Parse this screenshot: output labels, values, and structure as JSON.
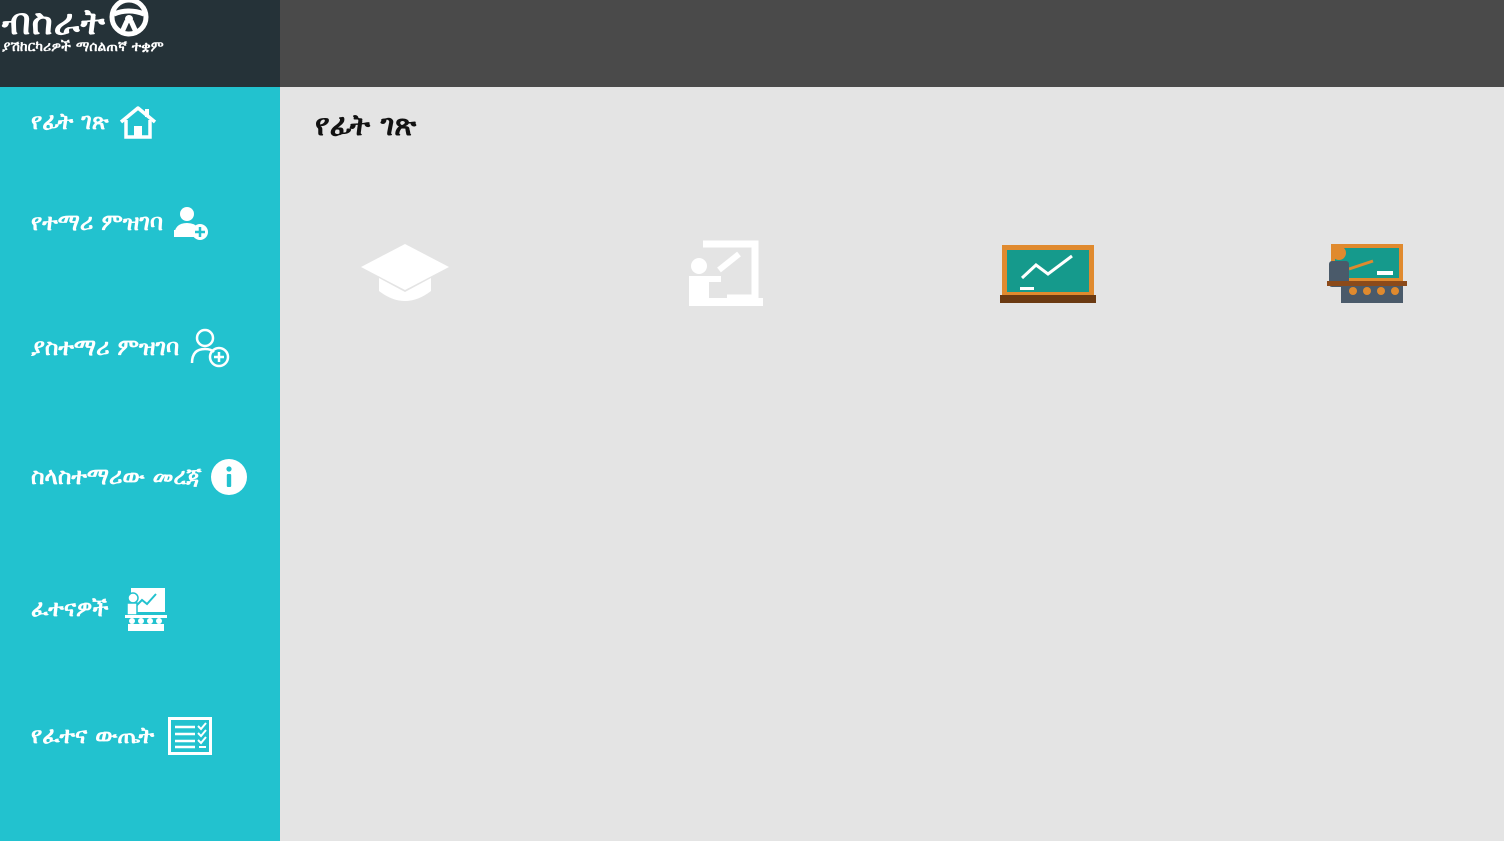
{
  "app": {
    "title": "ብስራት",
    "subtitle": "ያሽከርካሪዎች ማሰልጠኛ ተቋም",
    "logo_icon": "steering-wheel-icon"
  },
  "sidebar": {
    "items": [
      {
        "label": "የፊት ገጽ",
        "icon": "home-icon"
      },
      {
        "label": "የተማሪ ምዝገባ",
        "icon": "add-user-icon"
      },
      {
        "label": "ያስተማሪ ምዝገባ",
        "icon": "add-user-outline-icon"
      },
      {
        "label": "ስላስተማሪው መረጃ",
        "icon": "info-icon"
      },
      {
        "label": "ፈተናዎች",
        "icon": "classroom-icon"
      },
      {
        "label": "የፈተና ውጤት",
        "icon": "results-list-icon"
      }
    ]
  },
  "main": {
    "title": "የፊት ገጽ",
    "tiles": [
      {
        "name": "students",
        "icon": "graduation-cap-icon"
      },
      {
        "name": "teachers",
        "icon": "teacher-board-icon"
      },
      {
        "name": "reports",
        "icon": "chalkboard-chart-icon"
      },
      {
        "name": "exams",
        "icon": "classroom-presentation-icon"
      }
    ]
  },
  "colors": {
    "sidebar": "#22c2cf",
    "topbar": "#4a4a4a",
    "logo_bg": "#253238",
    "content_bg": "#e4e4e4"
  }
}
